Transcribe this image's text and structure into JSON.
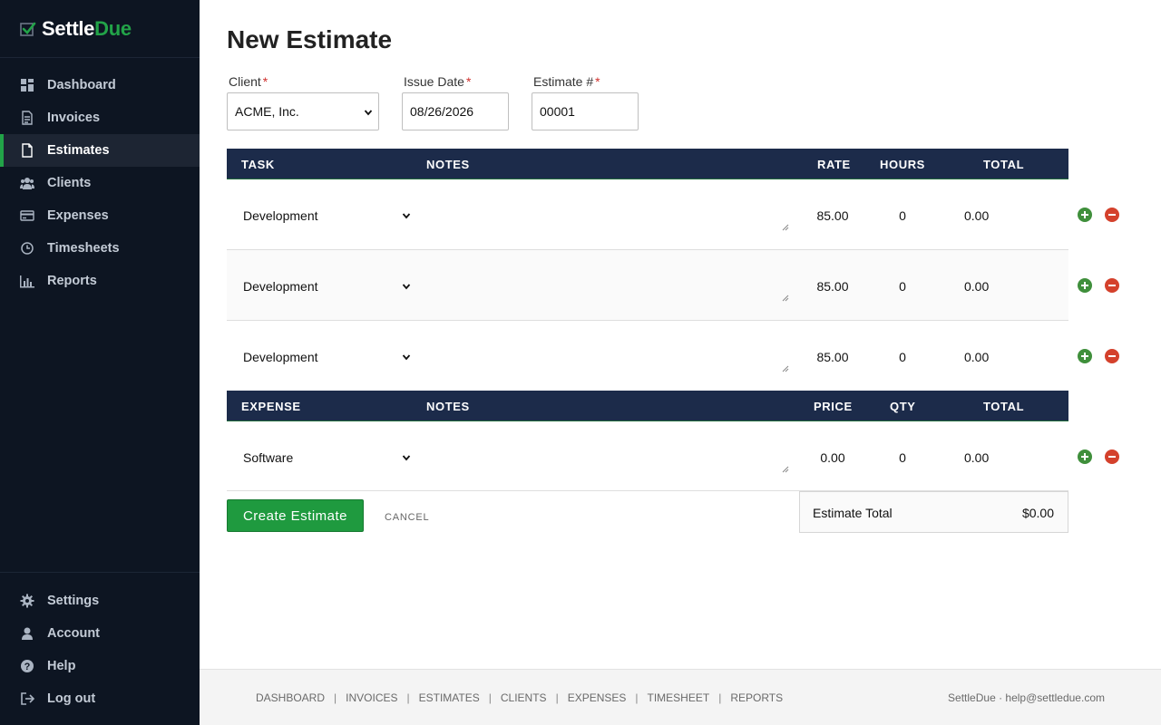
{
  "brand": {
    "name_main": "Settle",
    "name_accent": "Due",
    "accent_color": "#22a348"
  },
  "sidebar": {
    "nav": [
      {
        "label": "Dashboard",
        "icon": "dashboard-icon",
        "active": false
      },
      {
        "label": "Invoices",
        "icon": "invoice-icon",
        "active": false
      },
      {
        "label": "Estimates",
        "icon": "document-icon",
        "active": true
      },
      {
        "label": "Clients",
        "icon": "users-icon",
        "active": false
      },
      {
        "label": "Expenses",
        "icon": "credit-card-icon",
        "active": false
      },
      {
        "label": "Timesheets",
        "icon": "clock-icon",
        "active": false
      },
      {
        "label": "Reports",
        "icon": "bar-chart-icon",
        "active": false
      }
    ],
    "bottom": [
      {
        "label": "Settings",
        "icon": "gear-icon"
      },
      {
        "label": "Account",
        "icon": "user-icon"
      },
      {
        "label": "Help",
        "icon": "help-icon"
      },
      {
        "label": "Log out",
        "icon": "logout-icon"
      }
    ]
  },
  "page": {
    "title": "New Estimate"
  },
  "form": {
    "client_label": "Client",
    "client_value": "ACME, Inc.",
    "issue_date_label": "Issue Date",
    "issue_date_value": "08/26/2026",
    "estimate_num_label": "Estimate #",
    "estimate_num_value": "00001",
    "required_mark": "*"
  },
  "tasks_table": {
    "headers": {
      "task": "TASK",
      "notes": "NOTES",
      "rate": "RATE",
      "hours": "HOURS",
      "total": "TOTAL"
    },
    "rows": [
      {
        "task": "Development",
        "notes": "",
        "rate": "85.00",
        "hours": "0",
        "total": "0.00"
      },
      {
        "task": "Development",
        "notes": "",
        "rate": "85.00",
        "hours": "0",
        "total": "0.00"
      },
      {
        "task": "Development",
        "notes": "",
        "rate": "85.00",
        "hours": "0",
        "total": "0.00"
      }
    ]
  },
  "expenses_table": {
    "headers": {
      "expense": "EXPENSE",
      "notes": "NOTES",
      "price": "PRICE",
      "qty": "QTY",
      "total": "TOTAL"
    },
    "rows": [
      {
        "expense": "Software",
        "notes": "",
        "price": "0.00",
        "qty": "0",
        "total": "0.00"
      }
    ]
  },
  "actions": {
    "create_label": "Create Estimate",
    "cancel_label": "CANCEL"
  },
  "summary": {
    "total_label": "Estimate Total",
    "total_value": "$0.00"
  },
  "footer": {
    "links": [
      "DASHBOARD",
      "INVOICES",
      "ESTIMATES",
      "CLIENTS",
      "EXPENSES",
      "TIMESHEET",
      "REPORTS"
    ],
    "separator": "|",
    "right_text": "SettleDue · help@settledue.com"
  },
  "colors": {
    "sidebar_bg": "#0d1522",
    "table_header_bg": "#1c2b4a",
    "primary_button": "#1f9a3f",
    "add_icon": "#3f8f3b",
    "remove_icon": "#d4412c"
  }
}
